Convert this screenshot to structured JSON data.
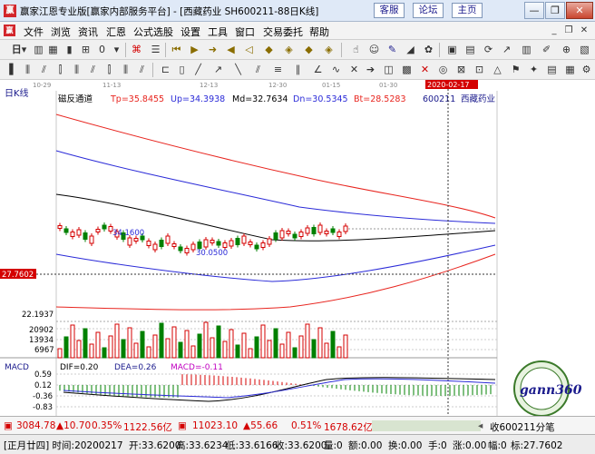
{
  "titlebar": {
    "app_icon": "赢",
    "title": "赢家江恩专业版[赢家内部服务平台] - [西藏药业  SH600211-88日K线]",
    "links": [
      "客服",
      "论坛",
      "主页"
    ],
    "controls": [
      "minimize-icon",
      "restore-icon",
      "close-icon"
    ]
  },
  "menubar": {
    "logo": "赢",
    "items": [
      "文件",
      "浏览",
      "资讯",
      "汇恩",
      "公式选股",
      "设置",
      "工具",
      "窗口",
      "交易委托",
      "帮助"
    ]
  },
  "toolbar1": {
    "period_label": "日",
    "icons": [
      "bar-chart-icon",
      "grid-icon",
      "k-line-icon",
      "fenshi-icon",
      "zero-icon",
      "formula-icon",
      "info-icon",
      "skip-first-icon",
      "play-icon",
      "arrow-right-icon",
      "arrow-left-icon",
      "play-left-icon",
      "diamond-up-icon",
      "diamond-down-icon",
      "diamond-left-icon",
      "diamond-right-icon",
      "hand-icon",
      "people-icon",
      "gann-icon",
      "fan-icon",
      "spiral-icon",
      "grid-square-icon",
      "sync-icon",
      "trend-icon",
      "calendar-icon",
      "candle-icon",
      "pen-icon",
      "zoom-icon"
    ]
  },
  "toolbar2": {
    "icons": [
      "bars-icon",
      "bars2-icon",
      "bars3-icon",
      "bars4-icon",
      "bars5-icon",
      "bars6-icon",
      "bars7-icon",
      "bars8-icon",
      "bars9-icon",
      "measure-icon",
      "rect-icon",
      "line-icon",
      "ray-icon",
      "segment-icon",
      "channel-icon",
      "fib-icon",
      "parallel-icon",
      "angle-icon",
      "wave-icon",
      "text-icon",
      "arrow-icon",
      "cycle-icon",
      "box-icon",
      "delete-icon",
      "circle-icon",
      "cross-icon",
      "check-icon",
      "triangle-icon",
      "flag-icon",
      "star-icon",
      "grid2-icon",
      "panel-icon",
      "layout-icon",
      "view-icon",
      "setting-icon",
      "image-icon",
      "print-icon",
      "ruler-icon"
    ]
  },
  "chart": {
    "period_label": "日K线",
    "date_ticks": [
      "10-29",
      "11-13",
      "12-13",
      "12-30",
      "01-15",
      "01-30"
    ],
    "cursor_date": "2020-02-17",
    "indicator_name": "磁反通道",
    "tp": "Tp=35.8455",
    "up": "Up=34.3938",
    "md": "Md=32.7634",
    "dn": "Dn=30.5345",
    "bt": "Bt=28.5283",
    "stock_code": "600211",
    "stock_name": "西藏药业",
    "cursor_price": "27.7602",
    "high_label": "34.1600",
    "low_label": "30.0500",
    "vol_top": "22.1937",
    "vol_ticks": [
      "20902",
      "13934",
      "6967"
    ],
    "macd_name": "MACD",
    "dif": "DIF=0.20",
    "dea": "DEA=0.26",
    "macd": "MACD=-0.11",
    "macd_ticks": [
      "0.59",
      "0.12",
      "-0.36",
      "-0.83"
    ],
    "logo_text": "gann360"
  },
  "indexbar": {
    "sh_value": "3084.78",
    "sh_change": "▲10.70",
    "sh_pct": "0.35%",
    "sh_amount": "1122.56亿",
    "sz_value": "11023.10",
    "sz_change": "▲55.66",
    "sz_pct": "0.51%",
    "sz_amount": "1678.62亿",
    "right_text": "收600211分笔"
  },
  "infobar": {
    "date": "[正月廿四] 时间:20200217",
    "open": "开:33.6200",
    "high": "高:33.6234",
    "low": "低:33.6166",
    "close": "收:33.6200",
    "volume": "量:0",
    "amount": "额:0.00",
    "turnover": "换:0.00",
    "shou": "手:0",
    "zhang": "涨:0.00",
    "fu": "幅:0",
    "biao": "标:27.7602"
  },
  "colors": {
    "up": "#d40000",
    "down": "#008000",
    "tp_line": "#e8251f",
    "up_line": "#2b2bd8",
    "md_line": "#000000",
    "dn_line": "#2b2bd8",
    "bt_line": "#e8251f"
  }
}
